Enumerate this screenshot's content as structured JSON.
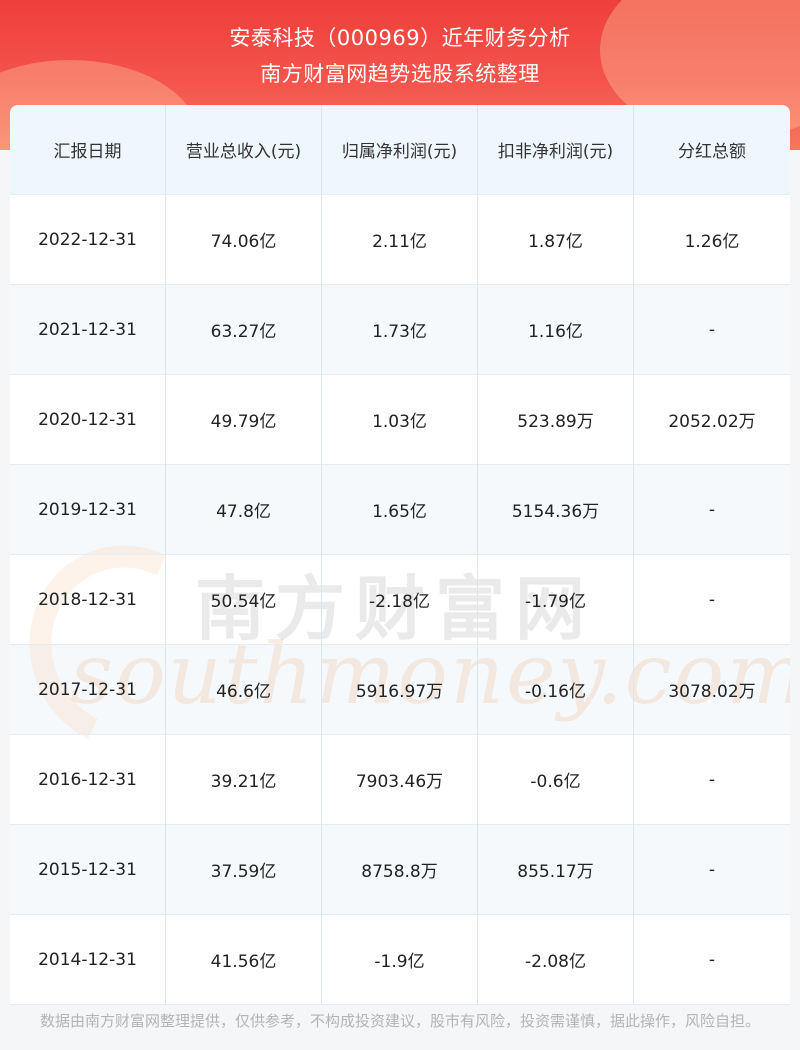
{
  "header": {
    "title": "安泰科技（000969）近年财务分析",
    "subtitle": "南方财富网趋势选股系统整理"
  },
  "table": {
    "columns": [
      "汇报日期",
      "营业总收入(元)",
      "归属净利润(元)",
      "扣非净利润(元)",
      "分红总额"
    ],
    "rows": [
      [
        "2022-12-31",
        "74.06亿",
        "2.11亿",
        "1.87亿",
        "1.26亿"
      ],
      [
        "2021-12-31",
        "63.27亿",
        "1.73亿",
        "1.16亿",
        "-"
      ],
      [
        "2020-12-31",
        "49.79亿",
        "1.03亿",
        "523.89万",
        "2052.02万"
      ],
      [
        "2019-12-31",
        "47.8亿",
        "1.65亿",
        "5154.36万",
        "-"
      ],
      [
        "2018-12-31",
        "50.54亿",
        "-2.18亿",
        "-1.79亿",
        "-"
      ],
      [
        "2017-12-31",
        "46.6亿",
        "5916.97万",
        "-0.16亿",
        "3078.02万"
      ],
      [
        "2016-12-31",
        "39.21亿",
        "7903.46万",
        "-0.6亿",
        "-"
      ],
      [
        "2015-12-31",
        "37.59亿",
        "8758.8万",
        "855.17万",
        "-"
      ],
      [
        "2014-12-31",
        "41.56亿",
        "-1.9亿",
        "-2.08亿",
        "-"
      ]
    ]
  },
  "watermark": {
    "cn": "南方财富网",
    "en": "southmoney.com"
  },
  "footer": {
    "disclaimer": "数据由南方财富网整理提供，仅供参考，不构成投资建议，股市有风险，投资需谨慎，据此操作，风险自担。"
  },
  "colors": {
    "header_red": "#ef3f3a",
    "header_row_bg": "#eef6fe",
    "stripe_bg": "#f6f9fc"
  }
}
